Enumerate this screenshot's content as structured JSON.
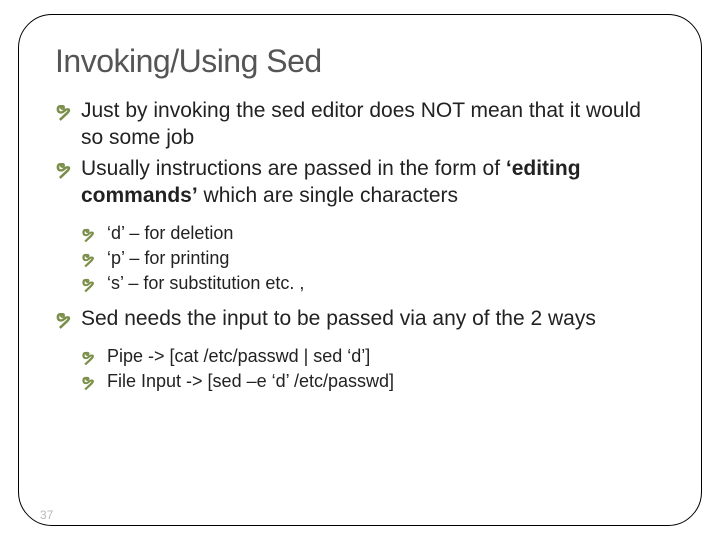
{
  "title": "Invoking/Using Sed",
  "bullets": {
    "b1a": "Just by invoking the sed editor does NOT mean that it would so some job",
    "b1b_pre": "Usually instructions are passed in the form of ",
    "b1b_bold": "‘editing commands’",
    "b1b_post": " which are single characters",
    "b2a": "‘d’ – for deletion",
    "b2b": "‘p’ – for printing",
    "b2c": "‘s’ – for substitution etc. ,",
    "b1c": "Sed needs the input to be passed via any of the 2 ways",
    "b2d_pre": "Pipe",
    "b2d_post": " -> [cat /etc/passwd | sed ‘d’]",
    "b2e_pre": "File Input ",
    "b2e_post": " -> [sed –e ‘d’ /etc/passwd]"
  },
  "glyph": "ຯ",
  "page": "37"
}
